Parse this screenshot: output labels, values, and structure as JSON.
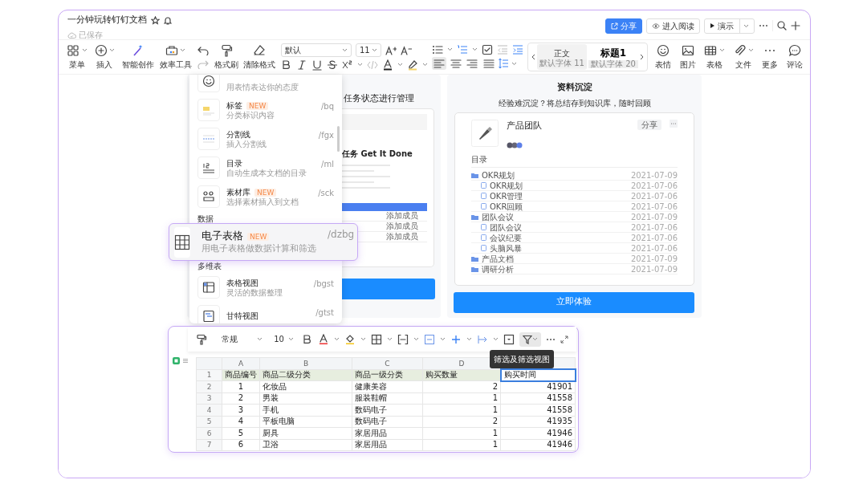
{
  "document": {
    "title": "一分钟玩转钉钉文档",
    "save_status": "已保存"
  },
  "header_actions": [
    {
      "kind": "share",
      "label": "分享"
    },
    {
      "kind": "read",
      "label": "进入阅读"
    },
    {
      "kind": "present",
      "label": "演示"
    }
  ],
  "toolbar": {
    "tools_left": [
      {
        "label": "菜单"
      },
      {
        "label": "插入"
      },
      {
        "label": "智能创作"
      },
      {
        "label": "效率工具"
      }
    ],
    "format_tools": [
      {
        "label": "格式刷"
      },
      {
        "label": "清除格式"
      }
    ],
    "font": "默认",
    "font_size": "11",
    "alignment": [
      {
        "selected": true
      },
      {
        "selected": false
      },
      {
        "selected": false
      },
      {
        "selected": false
      }
    ],
    "styles": [
      {
        "label": "正文",
        "font": "默认字体 11",
        "selected": true
      },
      {
        "label": "标题1",
        "font": "默认字体 20",
        "selected": false
      }
    ],
    "tools_right": [
      {
        "label": "表情"
      },
      {
        "label": "图片"
      },
      {
        "label": "表格"
      },
      {
        "label": "文件"
      },
      {
        "label": "更多"
      },
      {
        "label": "评论"
      }
    ]
  },
  "insert_menu": {
    "items": [
      {
        "kind": "item",
        "description": "用表情表达你的态度"
      },
      {
        "kind": "item",
        "label": "标签",
        "badge": "NEW",
        "shortcut": "/bq",
        "description": "分类标识内容"
      },
      {
        "kind": "item",
        "label": "分割线",
        "shortcut": "/fgx",
        "description": "插入分割线"
      },
      {
        "kind": "item",
        "label": "目录",
        "shortcut": "/ml",
        "description": "自动生成本文档的目录"
      },
      {
        "kind": "item",
        "label": "素材库",
        "badge": "NEW",
        "shortcut": "/sck",
        "description": "选择素材插入到文档"
      },
      {
        "kind": "section",
        "label": "数据"
      },
      {
        "kind": "gap"
      },
      {
        "kind": "section",
        "label": "多维表"
      },
      {
        "kind": "item",
        "label": "表格视图",
        "shortcut": "/bgst",
        "description": "灵活的数据整理"
      },
      {
        "kind": "item",
        "label": "甘特视图",
        "shortcut": "/gtst"
      }
    ]
  },
  "floating_item": {
    "label": "电子表格",
    "badge": "NEW",
    "shortcut": "/dzbg",
    "description": "用电子表格做数据计算和筛选"
  },
  "task_card": {
    "title": "任务状态进行管理",
    "heading": "任务 Get It Done",
    "rows": [
      "添加成员",
      "添加成员",
      "添加成员"
    ]
  },
  "kb_card": {
    "title": "资料沉淀",
    "subtitle": "经验难沉淀？将总结存到知识库，随时回顾",
    "team": "产品团队",
    "share": "分享",
    "toc_label": "目录",
    "cta": "立即体验",
    "tree": [
      {
        "label": "OKR规划",
        "date": "2021-07-09",
        "children": [
          {
            "label": "OKR规划",
            "date": "2021-07-06"
          },
          {
            "label": "OKR管理",
            "date": "2021-07-06"
          },
          {
            "label": "OKR回顾",
            "date": "2021-07-06"
          }
        ]
      },
      {
        "label": "团队会议",
        "date": "2021-07-09",
        "children": [
          {
            "label": "团队会议",
            "date": "2021-07-06"
          },
          {
            "label": "会议纪要",
            "date": "2021-07-06"
          },
          {
            "label": "头脑风暴",
            "date": "2021-07-06"
          }
        ]
      },
      {
        "label": "产品文档",
        "date": "2021-07-09"
      },
      {
        "label": "调研分析",
        "date": "2021-07-09"
      }
    ]
  },
  "sheet": {
    "number_format": "常规",
    "font_size": "10",
    "filter_selected": true,
    "tooltip": "筛选及筛选视图",
    "columns": [
      "A",
      "B",
      "C",
      "D"
    ],
    "rows": [
      {
        "number": "1",
        "header": true,
        "cells": [
          {
            "text": "商品编号",
            "selected": false
          },
          {
            "text": "商品二级分类",
            "selected": false
          },
          {
            "text": "商品一级分类",
            "selected": false
          },
          {
            "text": "购买数量",
            "selected": false
          },
          {
            "text": "购买时间",
            "selected": true
          }
        ]
      },
      {
        "number": "2",
        "header": false,
        "cells": [
          {
            "text": "1",
            "selected": false
          },
          {
            "text": "化妆品",
            "selected": false
          },
          {
            "text": "健康美容",
            "selected": false
          },
          {
            "text": "2",
            "selected": false
          },
          {
            "text": "41901",
            "selected": false
          }
        ]
      },
      {
        "number": "3",
        "header": false,
        "cells": [
          {
            "text": "2",
            "selected": false
          },
          {
            "text": "男装",
            "selected": false
          },
          {
            "text": "服装鞋帽",
            "selected": false
          },
          {
            "text": "1",
            "selected": false
          },
          {
            "text": "41558",
            "selected": false
          }
        ]
      },
      {
        "number": "4",
        "header": false,
        "cells": [
          {
            "text": "3",
            "selected": false
          },
          {
            "text": "手机",
            "selected": false
          },
          {
            "text": "数码电子",
            "selected": false
          },
          {
            "text": "1",
            "selected": false
          },
          {
            "text": "41558",
            "selected": false
          }
        ]
      },
      {
        "number": "5",
        "header": false,
        "cells": [
          {
            "text": "4",
            "selected": false
          },
          {
            "text": "平板电脑",
            "selected": false
          },
          {
            "text": "数码电子",
            "selected": false
          },
          {
            "text": "2",
            "selected": false
          },
          {
            "text": "41935",
            "selected": false
          }
        ]
      },
      {
        "number": "6",
        "header": false,
        "cells": [
          {
            "text": "5",
            "selected": false
          },
          {
            "text": "厨具",
            "selected": false
          },
          {
            "text": "家居用品",
            "selected": false
          },
          {
            "text": "1",
            "selected": false
          },
          {
            "text": "41946",
            "selected": false
          }
        ]
      },
      {
        "number": "7",
        "header": false,
        "cells": [
          {
            "text": "6",
            "selected": false
          },
          {
            "text": "卫浴",
            "selected": false
          },
          {
            "text": "家居用品",
            "selected": false
          },
          {
            "text": "1",
            "selected": false
          },
          {
            "text": "41946",
            "selected": false
          }
        ]
      }
    ]
  }
}
